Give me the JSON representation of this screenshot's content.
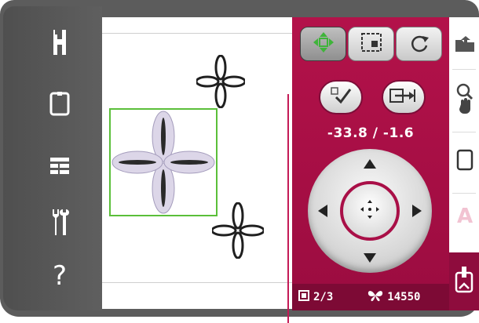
{
  "colors": {
    "bezel": "#5c5c5c",
    "panel": "#b3124a",
    "selection": "#5bbf3a",
    "status_bar": "#7d0a35"
  },
  "left_toolbar": {
    "items": [
      {
        "name": "edit-tool",
        "icon": "h-frame-icon"
      },
      {
        "name": "hoop-tool",
        "icon": "hoop-icon"
      },
      {
        "name": "list-tool",
        "icon": "list-icon"
      },
      {
        "name": "settings-tool",
        "icon": "tools-icon"
      },
      {
        "name": "help-tool",
        "icon": "question-icon",
        "label": "?"
      }
    ]
  },
  "panel": {
    "tabs": [
      {
        "icon": "move-icon",
        "active": true
      },
      {
        "icon": "select-area-icon",
        "active": false
      },
      {
        "icon": "rotate-icon",
        "active": false
      }
    ],
    "buttons": [
      {
        "icon": "checkmark-icon"
      },
      {
        "icon": "center-hoop-icon"
      }
    ],
    "coordinates": "-33.8 / -1.6"
  },
  "status": {
    "position": "2/3",
    "stitch_count": "14550"
  },
  "side_strip": {
    "items": [
      {
        "icon": "folder-icon"
      },
      {
        "icon": "zoom-pan-icon"
      },
      {
        "icon": "hoop-outline-icon"
      },
      {
        "icon": "a-text-icon",
        "label": "A"
      },
      {
        "icon": "embroidery-machine-icon"
      }
    ]
  }
}
